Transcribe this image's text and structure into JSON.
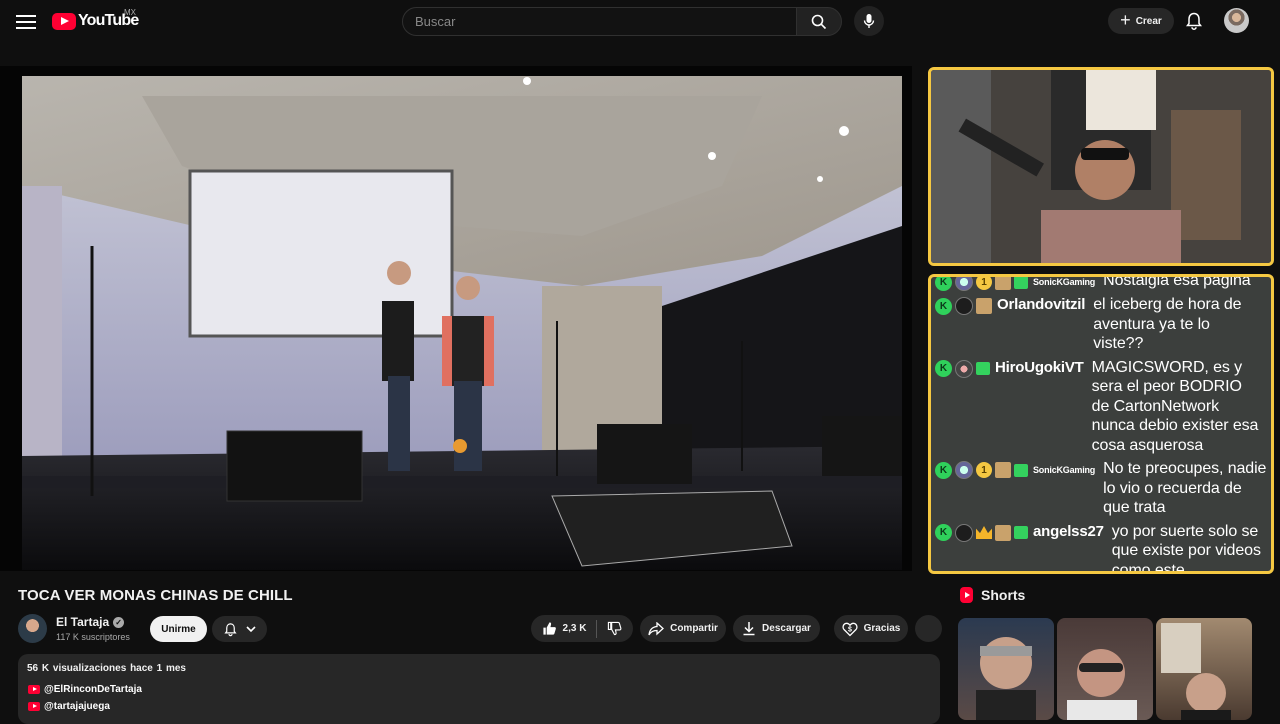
{
  "header": {
    "brand": "YouTube",
    "country": "MX",
    "search_placeholder": "Buscar",
    "create_label": "Crear"
  },
  "video": {
    "title": "TOCA VER MONAS CHINAS DE CHILL",
    "channel": {
      "name": "El Tartaja",
      "subscribers": "117 K suscriptores",
      "join_label": "Unirme"
    },
    "actions": {
      "likes": "2,3 K",
      "share": "Compartir",
      "download": "Descargar",
      "thanks": "Gracias"
    },
    "description": {
      "views": "56 K visualizaciones",
      "date": "hace 1 mes",
      "links": [
        "@ElRinconDeTartaja",
        "@tartajajuega"
      ]
    }
  },
  "chat": {
    "messages": [
      {
        "user": "SonicKGaming",
        "text": "Nostalgia esa pagina"
      },
      {
        "user": "Orlandovitzil",
        "text": "el iceberg de hora de aventura ya te lo viste??"
      },
      {
        "user": "HiroUgokiVT",
        "text": "MAGICSWORD, es y sera el peor BODRIO de CartonNetwork nunca debio exister esa cosa asquerosa"
      },
      {
        "user": "SonicKGaming",
        "text": "No te preocupes, nadie lo vio o recuerda de que trata"
      },
      {
        "user": "angelss27",
        "text": "yo por suerte solo se que existe por videos como este"
      }
    ],
    "badge_letter": "K",
    "gold_badge": "1"
  },
  "shorts": {
    "title": "Shorts"
  },
  "colors": {
    "accent_red": "#ff0033",
    "overlay_border": "#f5c842",
    "chat_badge_green": "#2fd15b"
  }
}
